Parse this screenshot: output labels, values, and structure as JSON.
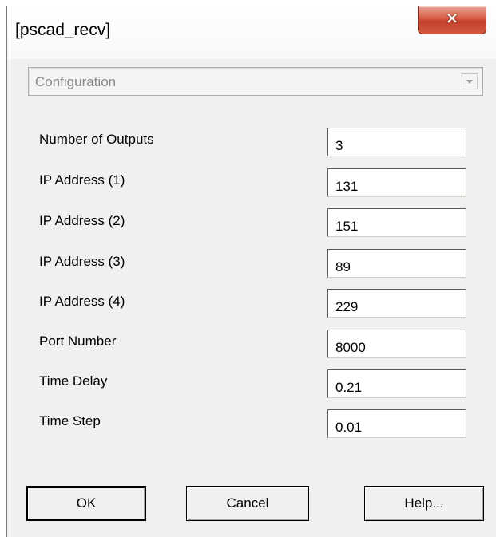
{
  "window": {
    "title": "[pscad_recv]",
    "close_glyph": "✕"
  },
  "config": {
    "selected": "Configuration"
  },
  "fields": [
    {
      "label": "Number of Outputs",
      "value": "3"
    },
    {
      "label": "IP Address (1)",
      "value": "131"
    },
    {
      "label": "IP Address (2)",
      "value": "151"
    },
    {
      "label": "IP Address (3)",
      "value": "89"
    },
    {
      "label": "IP Address (4)",
      "value": "229"
    },
    {
      "label": "Port Number",
      "value": "8000"
    },
    {
      "label": "Time Delay",
      "value": "0.21"
    },
    {
      "label": "Time Step",
      "value": "0.01"
    }
  ],
  "buttons": {
    "ok": "OK",
    "cancel": "Cancel",
    "help": "Help..."
  },
  "icons": {
    "close": "close-icon",
    "dropdown": "chevron-down-icon"
  },
  "colors": {
    "dialog_bg": "#f0f0f0",
    "close_button": "#c4402a",
    "disabled_text": "#8a8a8a"
  }
}
